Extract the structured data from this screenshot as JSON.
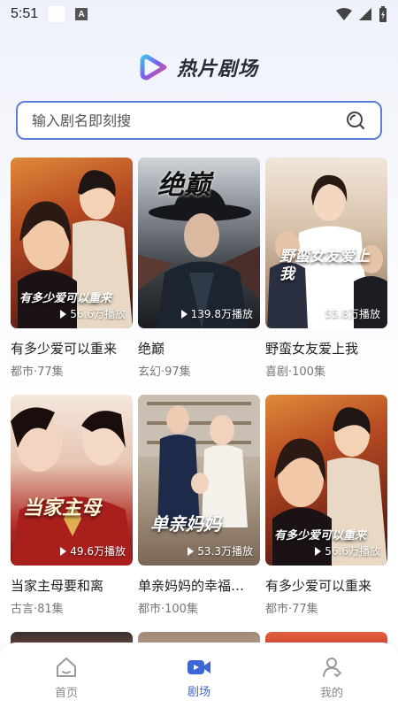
{
  "status_bar": {
    "time": "5:51",
    "notif_badge": "A"
  },
  "header": {
    "title": "热片剧场"
  },
  "search": {
    "placeholder": "输入剧名即刻搜"
  },
  "cards": [
    {
      "title": "有多少爱可以重来",
      "meta": "都市·77集",
      "plays": "56.6万播放",
      "art": "有多少爱可以重来"
    },
    {
      "title": "绝巅",
      "meta": "玄幻·97集",
      "plays": "139.8万播放",
      "art": "绝巅"
    },
    {
      "title": "野蛮女友爱上我",
      "meta": "喜剧·100集",
      "plays": "55.8万播放",
      "art": "野蛮女友爱上我"
    },
    {
      "title": "当家主母要和离",
      "meta": "古言·81集",
      "plays": "49.6万播放",
      "art": "当家主母"
    },
    {
      "title": "单亲妈妈的幸福…",
      "meta": "都市·100集",
      "plays": "53.3万播放",
      "art": "单亲妈妈"
    },
    {
      "title": "有多少爱可以重来",
      "meta": "都市·77集",
      "plays": "56.6万播放",
      "art": "有多少爱可以重来"
    }
  ],
  "nav": [
    {
      "label": "首页"
    },
    {
      "label": "剧场"
    },
    {
      "label": "我的"
    }
  ]
}
